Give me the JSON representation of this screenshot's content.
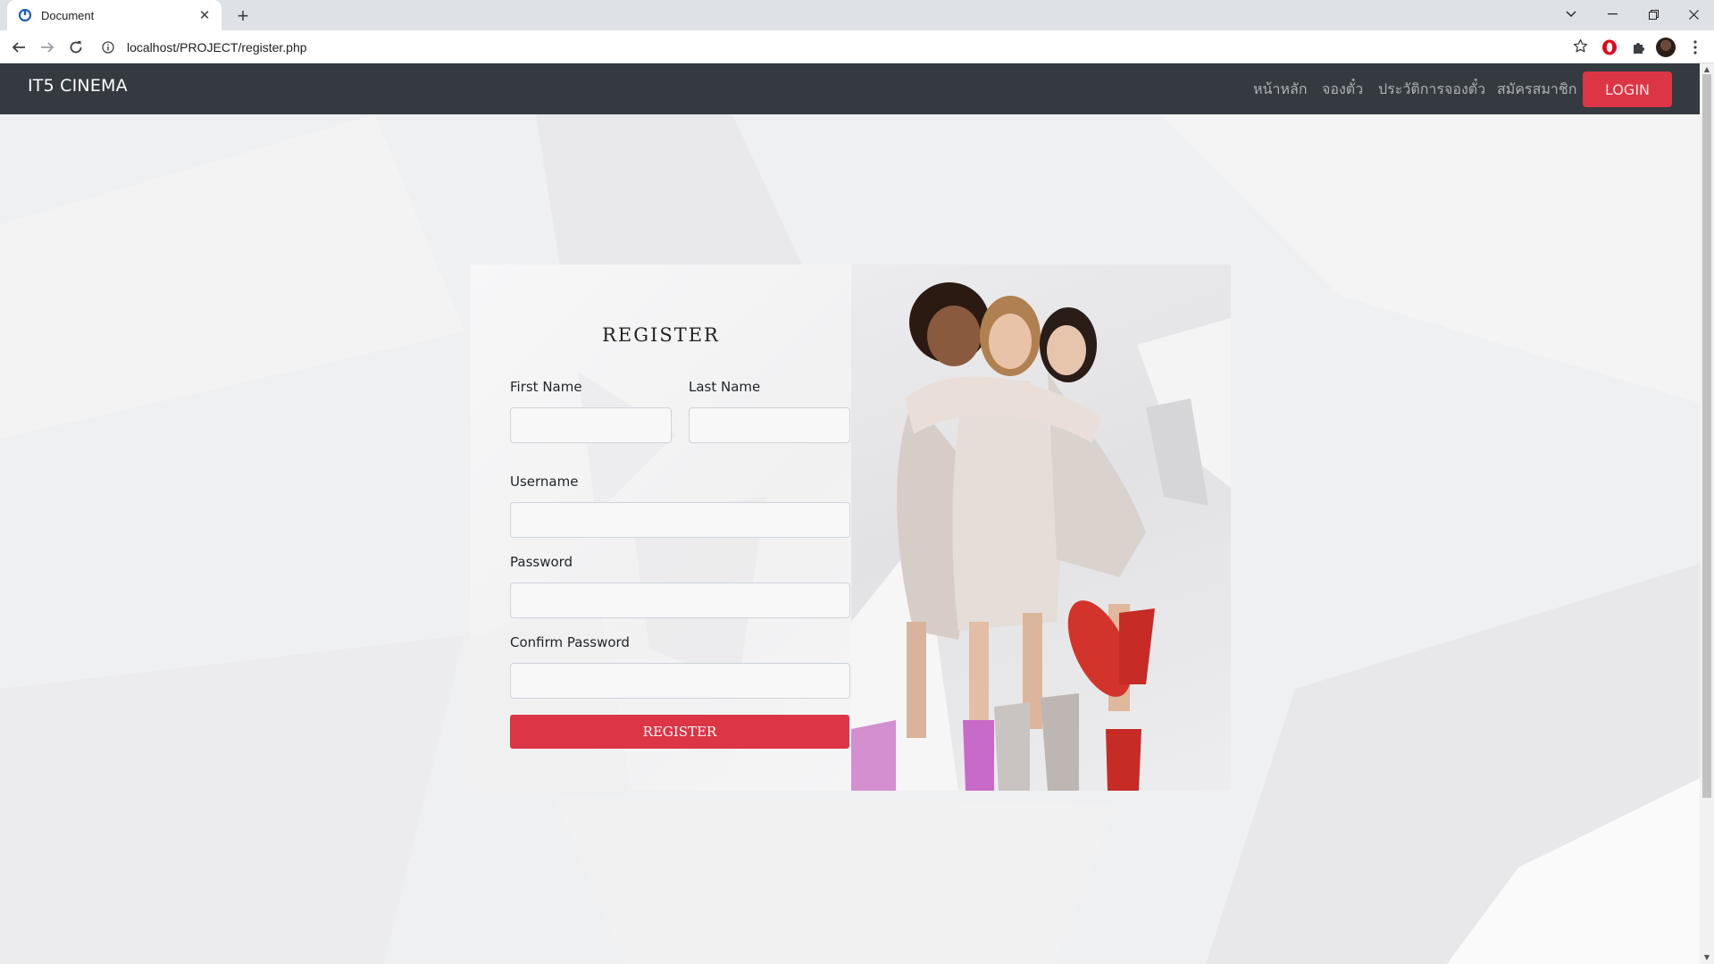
{
  "browser": {
    "tab_title": "Document",
    "url": "localhost/PROJECT/register.php"
  },
  "icons": {
    "favicon": "site-favicon-icon",
    "tab_close": "close-icon",
    "new_tab": "plus-icon",
    "back": "arrow-left-icon",
    "forward": "arrow-right-icon",
    "reload": "reload-icon",
    "info": "info-icon",
    "bookmark": "star-icon",
    "extension_opera": "opera-icon",
    "extensions": "puzzle-icon",
    "profile": "avatar",
    "menu": "kebab-menu-icon"
  },
  "navbar": {
    "brand": "IT5 CINEMA",
    "links": [
      "หน้าหลัก",
      "จองตั๋ว",
      "ประวัติการจองตั๋ว",
      "สมัครสมาชิก"
    ],
    "login_label": "LOGIN"
  },
  "form": {
    "heading": "REGISTER",
    "first_name_label": "First Name",
    "last_name_label": "Last Name",
    "username_label": "Username",
    "password_label": "Password",
    "confirm_password_label": "Confirm Password",
    "first_name_value": "",
    "last_name_value": "",
    "username_value": "",
    "password_value": "",
    "confirm_password_value": "",
    "submit_label": "REGISTER"
  },
  "colors": {
    "navbar_bg": "#343a40",
    "accent": "#dc3545",
    "page_bg": "#eff0f2"
  }
}
